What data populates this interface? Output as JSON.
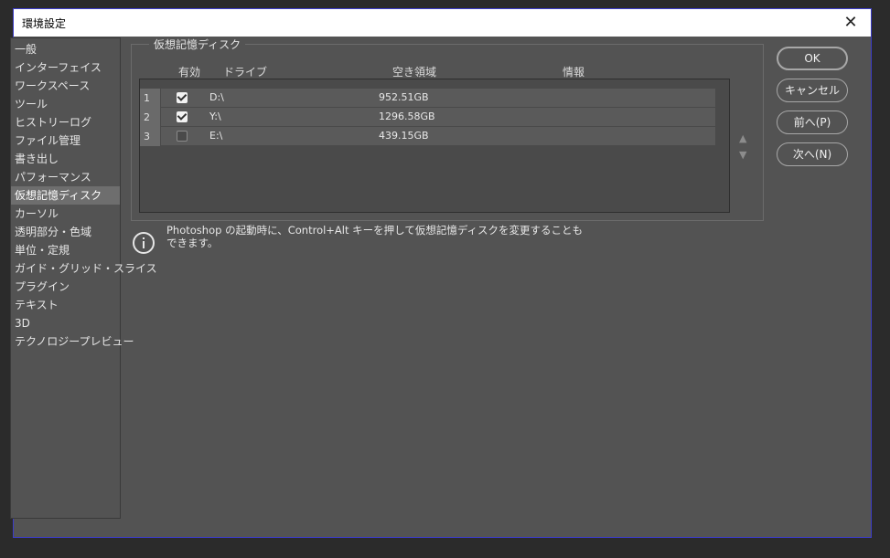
{
  "window": {
    "title": "環境設定",
    "close_glyph": "✕"
  },
  "nav": {
    "items": [
      "一般",
      "インターフェイス",
      "ワークスペース",
      "ツール",
      "ヒストリーログ",
      "ファイル管理",
      "書き出し",
      "パフォーマンス",
      "仮想記憶ディスク",
      "カーソル",
      "透明部分・色域",
      "単位・定規",
      "ガイド・グリッド・スライス",
      "プラグイン",
      "テキスト",
      "3D",
      "テクノロジープレビュー"
    ],
    "selected": "仮想記憶ディスク"
  },
  "panel": {
    "group_title": "仮想記憶ディスク",
    "columns": {
      "enabled": "有効",
      "drive": "ドライブ",
      "free": "空き領域",
      "info": "情報"
    },
    "rows": [
      {
        "num": "1",
        "enabled": true,
        "drive": "D:\\",
        "free": "952.51GB",
        "info": ""
      },
      {
        "num": "2",
        "enabled": true,
        "drive": "Y:\\",
        "free": "1296.58GB",
        "info": ""
      },
      {
        "num": "3",
        "enabled": false,
        "drive": "E:\\",
        "free": "439.15GB",
        "info": ""
      }
    ],
    "move_up_glyph": "▲",
    "move_down_glyph": "▼"
  },
  "buttons": {
    "ok": "OK",
    "cancel": "キャンセル",
    "prev": "前へ(P)",
    "next": "次へ(N)"
  },
  "info": {
    "line1": "Photoshop の起動時に、Control+Alt キーを押して仮想記憶ディスクを変更することも",
    "line2": "できます。",
    "icon": "info-icon"
  }
}
